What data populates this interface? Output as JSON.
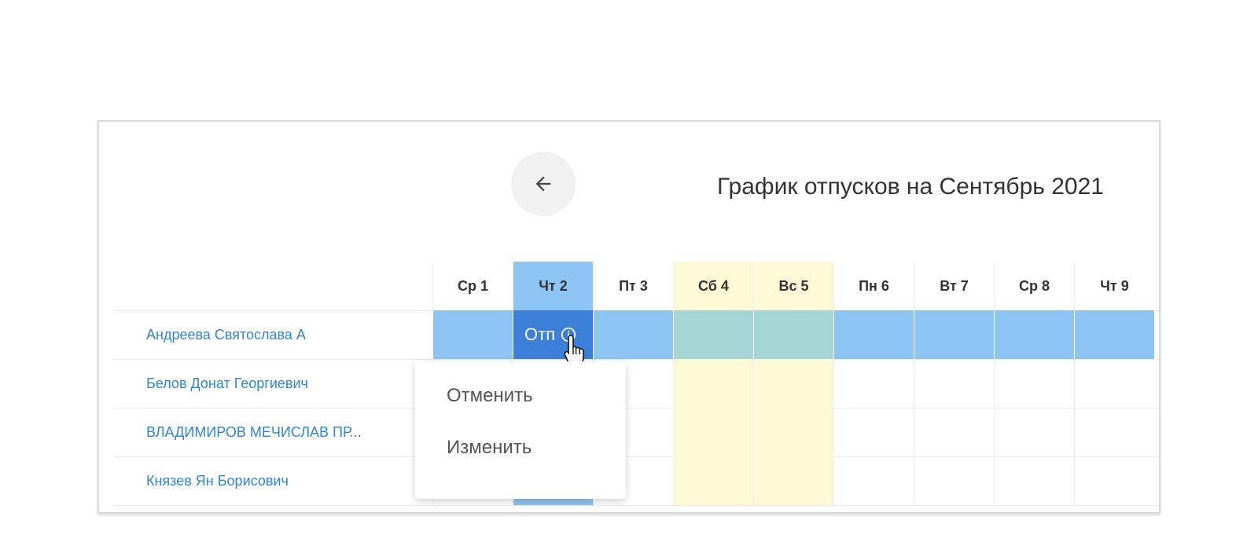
{
  "header": {
    "title": "График отпусков на Сентябрь 2021",
    "back_icon": "arrow-left-icon"
  },
  "days": [
    {
      "label": "Ср 1",
      "weekend": false,
      "active": false
    },
    {
      "label": "Чт 2",
      "weekend": false,
      "active": true
    },
    {
      "label": "Пт 3",
      "weekend": false,
      "active": false
    },
    {
      "label": "Сб 4",
      "weekend": true,
      "active": false
    },
    {
      "label": "Вс 5",
      "weekend": true,
      "active": false
    },
    {
      "label": "Пн 6",
      "weekend": false,
      "active": false
    },
    {
      "label": "Вт 7",
      "weekend": false,
      "active": false
    },
    {
      "label": "Ср 8",
      "weekend": false,
      "active": false
    },
    {
      "label": "Чт 9",
      "weekend": false,
      "active": false
    }
  ],
  "employees": [
    {
      "name": "Андреева Святослава А"
    },
    {
      "name": "Белов Донат Георгиевич"
    },
    {
      "name": "ВЛАДИМИРОВ МЕЧИСЛАВ ПР..."
    },
    {
      "name": "Князев Ян Борисович"
    }
  ],
  "vacation": {
    "label": "Отп",
    "info_icon": "info-icon",
    "cursor_icon": "hand-pointer-icon"
  },
  "context_menu": {
    "cancel_label": "Отменить",
    "edit_label": "Изменить"
  },
  "colors": {
    "vacation": "#8cc4f4",
    "vacation_start": "#3c7fd9",
    "weekend": "#fdf9d6",
    "vacation_weekend": "#a4d4d4",
    "link": "#2f86d6"
  }
}
